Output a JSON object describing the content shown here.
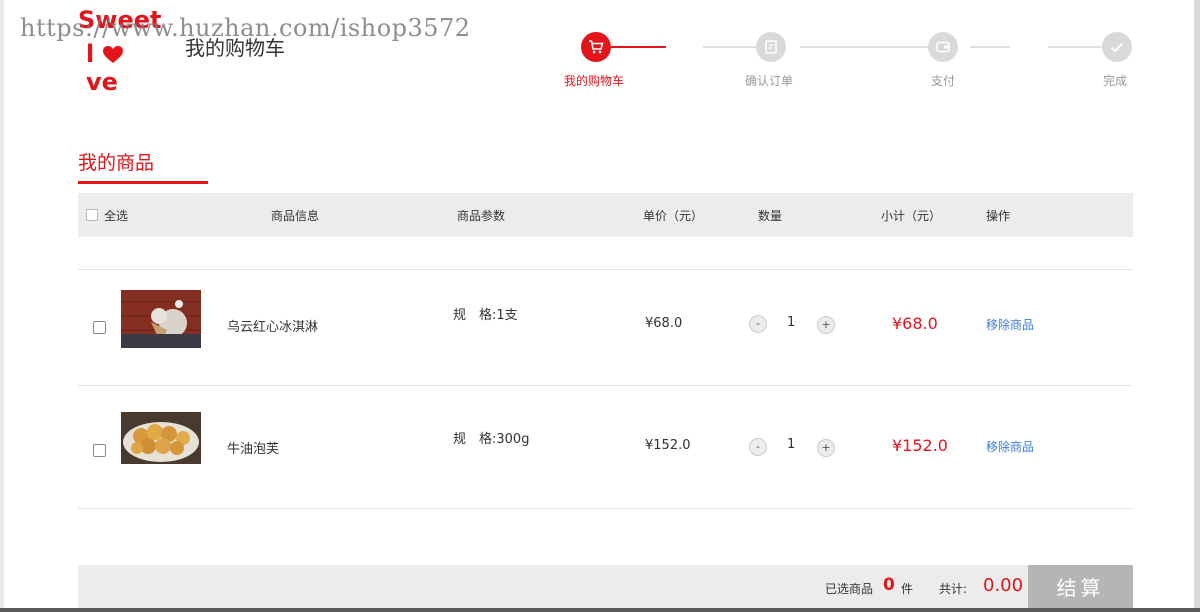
{
  "watermark": "https://www.huzhan.com/ishop3572",
  "logo": {
    "line1": "Sweet",
    "line2_left": "l",
    "line2_right": "ve"
  },
  "page_title": "我的购物车",
  "steps": [
    {
      "label": "我的购物车",
      "icon": "cart-icon",
      "active": true
    },
    {
      "label": "确认订单",
      "icon": "order-icon",
      "active": false
    },
    {
      "label": "支付",
      "icon": "wallet-icon",
      "active": false
    },
    {
      "label": "完成",
      "icon": "check-icon",
      "active": false
    }
  ],
  "section_title": "我的商品",
  "table_header": {
    "select_all": "全选",
    "product_info": "商品信息",
    "product_params": "商品参数",
    "unit_price": "单价（元）",
    "quantity": "数量",
    "subtotal": "小计（元）",
    "actions": "操作"
  },
  "items": [
    {
      "name": "乌云红心冰淇淋",
      "spec": "规　格:1支",
      "price": "¥68.0",
      "qty_minus": "-",
      "quantity": "1",
      "qty_plus": "+",
      "subtotal": "¥68.0",
      "remove": "移除商品"
    },
    {
      "name": "牛油泡芙",
      "spec": "规　格:300g",
      "price": "¥152.0",
      "qty_minus": "-",
      "quantity": "1",
      "qty_plus": "+",
      "subtotal": "¥152.0",
      "remove": "移除商品"
    }
  ],
  "footer": {
    "selected_label": "已选商品",
    "selected_count": "0",
    "selected_unit": "件",
    "total_label": "共计:",
    "total_amount": "0.00",
    "checkout_label": "结算"
  },
  "colors": {
    "accent": "#e3141a",
    "link": "#3a7bd5",
    "header_bg": "#ececec",
    "button_disabled": "#b5b5b5"
  }
}
